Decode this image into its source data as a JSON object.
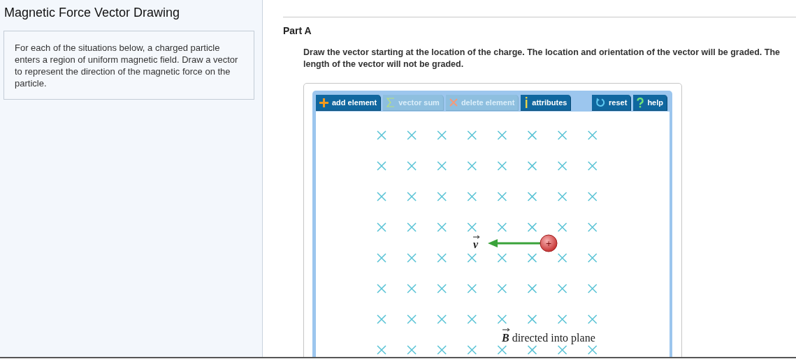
{
  "sidebar": {
    "title": "Magnetic Force Vector Drawing",
    "intro": "For each of the situations below, a charged particle enters a region of uniform magnetic field. Draw a vector to represent the direction of the magnetic force on the particle."
  },
  "part": {
    "title": "Part A",
    "instructions": "Draw the vector starting at the location of the charge. The location and orientation of the vector will be graded. The length of the vector will not be graded."
  },
  "toolbar": [
    {
      "kind": "add",
      "label": "add element",
      "disabled": false
    },
    {
      "kind": "sum",
      "label": "vector sum",
      "disabled": true
    },
    {
      "kind": "delete",
      "label": "delete element",
      "disabled": true
    },
    {
      "kind": "info",
      "label": "attributes",
      "disabled": false
    },
    {
      "kind": "reset",
      "label": "reset",
      "disabled": false
    },
    {
      "kind": "help",
      "label": "help",
      "disabled": false
    }
  ],
  "canvas": {
    "charge_sign": "+",
    "velocity_label": "v",
    "field_label": "B",
    "field_caption": "directed into plane"
  }
}
